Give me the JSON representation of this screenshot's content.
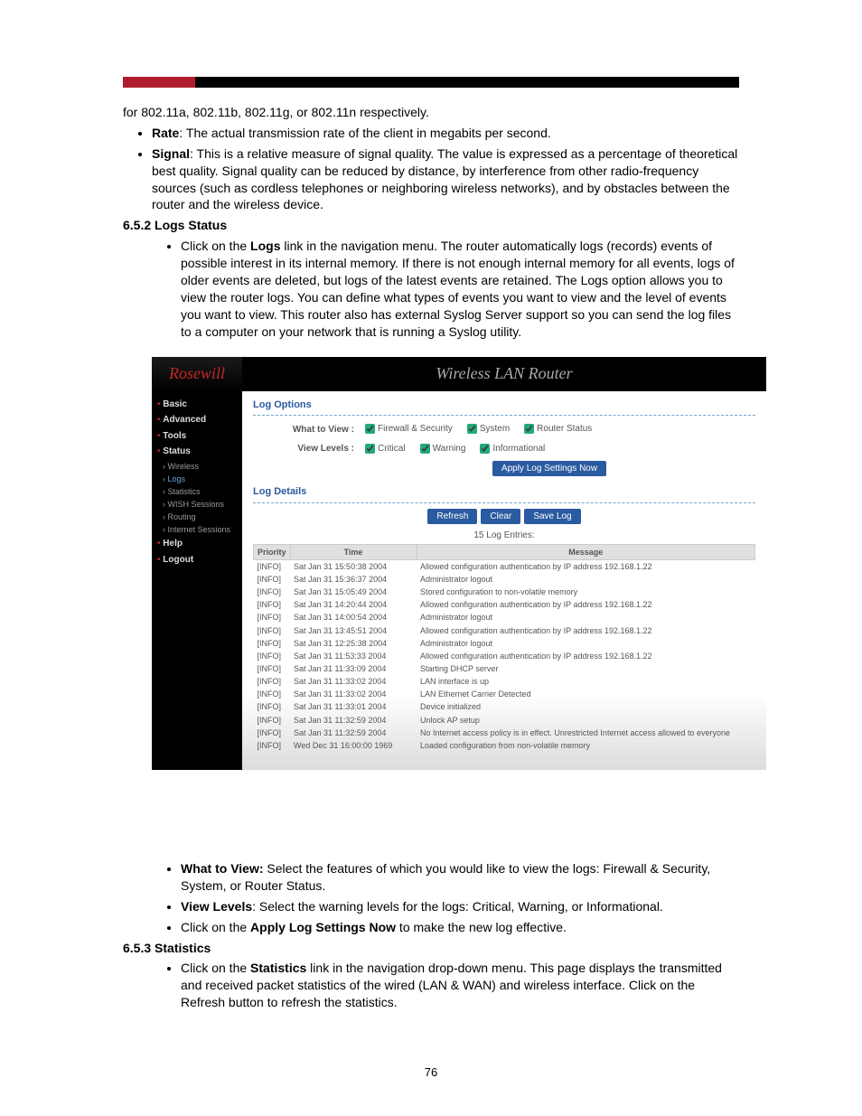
{
  "intro": {
    "line1": "for 802.11a, 802.11b, 802.11g, or 802.11n respectively.",
    "rate_label": "Rate",
    "rate_text": ": The actual transmission rate of the client in megabits per second.",
    "signal_label": "Signal",
    "signal_text": ": This is a relative measure of signal quality. The value is expressed as a percentage of theoretical best quality. Signal quality can be reduced by distance, by interference from other radio-frequency sources (such as cordless telephones or neighboring wireless networks), and by obstacles between the router and the wireless device."
  },
  "sec652": {
    "title": "6.5.2  Logs Status",
    "bullet_pre": "Click on the ",
    "bullet_bold": "Logs",
    "bullet_post": " link in the navigation menu. The router automatically logs (records) events of possible interest in its internal memory. If there is not enough internal memory for all events, logs of older events are deleted, but logs of the latest events are retained. The Logs option allows you to view the router logs. You can define what types of events you want to view and the level of events you want to view. This router also has external Syslog Server support so you can send the log files to a computer on your network that is running a Syslog utility."
  },
  "ui": {
    "logo_text": "Rosewill",
    "header_title": "Wireless LAN Router",
    "nav": [
      {
        "label": "Basic",
        "type": "main"
      },
      {
        "label": "Advanced",
        "type": "main"
      },
      {
        "label": "Tools",
        "type": "main"
      },
      {
        "label": "Status",
        "type": "main"
      },
      {
        "label": "Wireless",
        "type": "sub"
      },
      {
        "label": "Logs",
        "type": "sub",
        "active": true
      },
      {
        "label": "Statistics",
        "type": "sub"
      },
      {
        "label": "WISH Sessions",
        "type": "sub"
      },
      {
        "label": "Routing",
        "type": "sub"
      },
      {
        "label": "Internet Sessions",
        "type": "sub"
      },
      {
        "label": "Help",
        "type": "main"
      },
      {
        "label": "Logout",
        "type": "main"
      }
    ],
    "log_options": {
      "heading": "Log Options",
      "what_to_view_label": "What to View :",
      "what_to_view": [
        "Firewall & Security",
        "System",
        "Router Status"
      ],
      "view_levels_label": "View Levels :",
      "view_levels": [
        "Critical",
        "Warning",
        "Informational"
      ],
      "apply_btn": "Apply Log Settings Now"
    },
    "log_details": {
      "heading": "Log Details",
      "buttons": [
        "Refresh",
        "Clear",
        "Save Log"
      ],
      "count_text": "15 Log Entries:",
      "columns": [
        "Priority",
        "Time",
        "Message"
      ],
      "rows": [
        {
          "p": "[INFO]",
          "t": "Sat Jan 31 15:50:38 2004",
          "m": "Allowed configuration authentication by IP address 192.168.1.22"
        },
        {
          "p": "[INFO]",
          "t": "Sat Jan 31 15:36:37 2004",
          "m": "Administrator logout"
        },
        {
          "p": "[INFO]",
          "t": "Sat Jan 31 15:05:49 2004",
          "m": "Stored configuration to non-volatile memory"
        },
        {
          "p": "[INFO]",
          "t": "Sat Jan 31 14:20:44 2004",
          "m": "Allowed configuration authentication by IP address 192.168.1.22"
        },
        {
          "p": "[INFO]",
          "t": "Sat Jan 31 14:00:54 2004",
          "m": "Administrator logout"
        },
        {
          "p": "[INFO]",
          "t": "Sat Jan 31 13:45:51 2004",
          "m": "Allowed configuration authentication by IP address 192.168.1.22"
        },
        {
          "p": "[INFO]",
          "t": "Sat Jan 31 12:25:38 2004",
          "m": "Administrator logout"
        },
        {
          "p": "[INFO]",
          "t": "Sat Jan 31 11:53:33 2004",
          "m": "Allowed configuration authentication by IP address 192.168.1.22"
        },
        {
          "p": "[INFO]",
          "t": "Sat Jan 31 11:33:09 2004",
          "m": "Starting DHCP server"
        },
        {
          "p": "[INFO]",
          "t": "Sat Jan 31 11:33:02 2004",
          "m": "LAN interface is up"
        },
        {
          "p": "[INFO]",
          "t": "Sat Jan 31 11:33:02 2004",
          "m": "LAN Ethernet Carrier Detected"
        },
        {
          "p": "[INFO]",
          "t": "Sat Jan 31 11:33:01 2004",
          "m": "Device initialized"
        },
        {
          "p": "[INFO]",
          "t": "Sat Jan 31 11:32:59 2004",
          "m": "Unlock AP setup"
        },
        {
          "p": "[INFO]",
          "t": "Sat Jan 31 11:32:59 2004",
          "m": "No Internet access policy is in effect. Unrestricted Internet access allowed to everyone"
        },
        {
          "p": "[INFO]",
          "t": "Wed Dec 31 16:00:00 1969",
          "m": "Loaded configuration from non-volatile memory"
        }
      ]
    }
  },
  "post_ui": {
    "b1_bold": "What to View:",
    "b1_text": " Select the features of which you would like to view the logs: Firewall & Security, System, or Router Status.",
    "b2_bold": "View Levels",
    "b2_text": ": Select the warning levels for the logs: Critical, Warning, or Informational.",
    "b3_pre": "Click on the ",
    "b3_bold": "Apply Log Settings Now",
    "b3_post": " to make the new log effective."
  },
  "sec653": {
    "title": "6.5.3  Statistics",
    "bullet_pre": "Click on the ",
    "bullet_bold": "Statistics",
    "bullet_post": " link in the navigation drop-down menu. This page displays the transmitted and received packet statistics of the wired (LAN & WAN) and wireless interface.  Click on the Refresh button to refresh the statistics."
  },
  "page_number": "76"
}
